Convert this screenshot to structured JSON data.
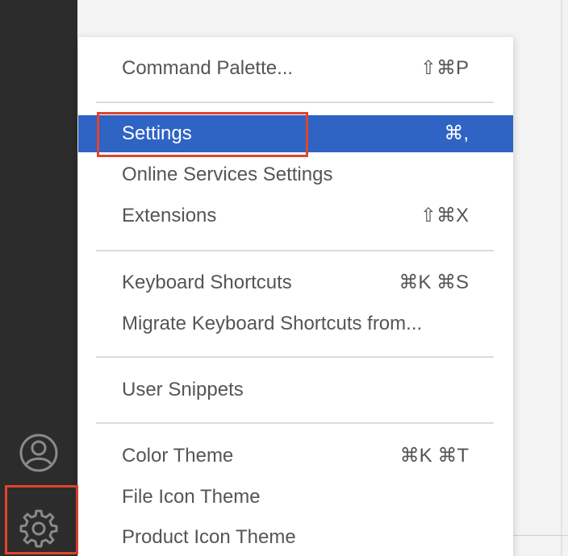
{
  "activity_bar": {
    "icons": [
      "account-icon",
      "gear-icon"
    ]
  },
  "menu": {
    "items": [
      {
        "label": "Command Palette...",
        "shortcut": "⇧⌘P"
      },
      {
        "label": "Settings",
        "shortcut": "⌘,"
      },
      {
        "label": "Online Services Settings",
        "shortcut": ""
      },
      {
        "label": "Extensions",
        "shortcut": "⇧⌘X"
      },
      {
        "label": "Keyboard Shortcuts",
        "shortcut": "⌘K ⌘S"
      },
      {
        "label": "Migrate Keyboard Shortcuts from...",
        "shortcut": ""
      },
      {
        "label": "User Snippets",
        "shortcut": ""
      },
      {
        "label": "Color Theme",
        "shortcut": "⌘K ⌘T"
      },
      {
        "label": "File Icon Theme",
        "shortcut": ""
      },
      {
        "label": "Product Icon Theme",
        "shortcut": ""
      }
    ],
    "selected_index": 1
  },
  "colors": {
    "activity_bar": "#2c2c2c",
    "selection": "#2f63c4",
    "annotation": "#e0442c",
    "menu_text": "#555555"
  }
}
